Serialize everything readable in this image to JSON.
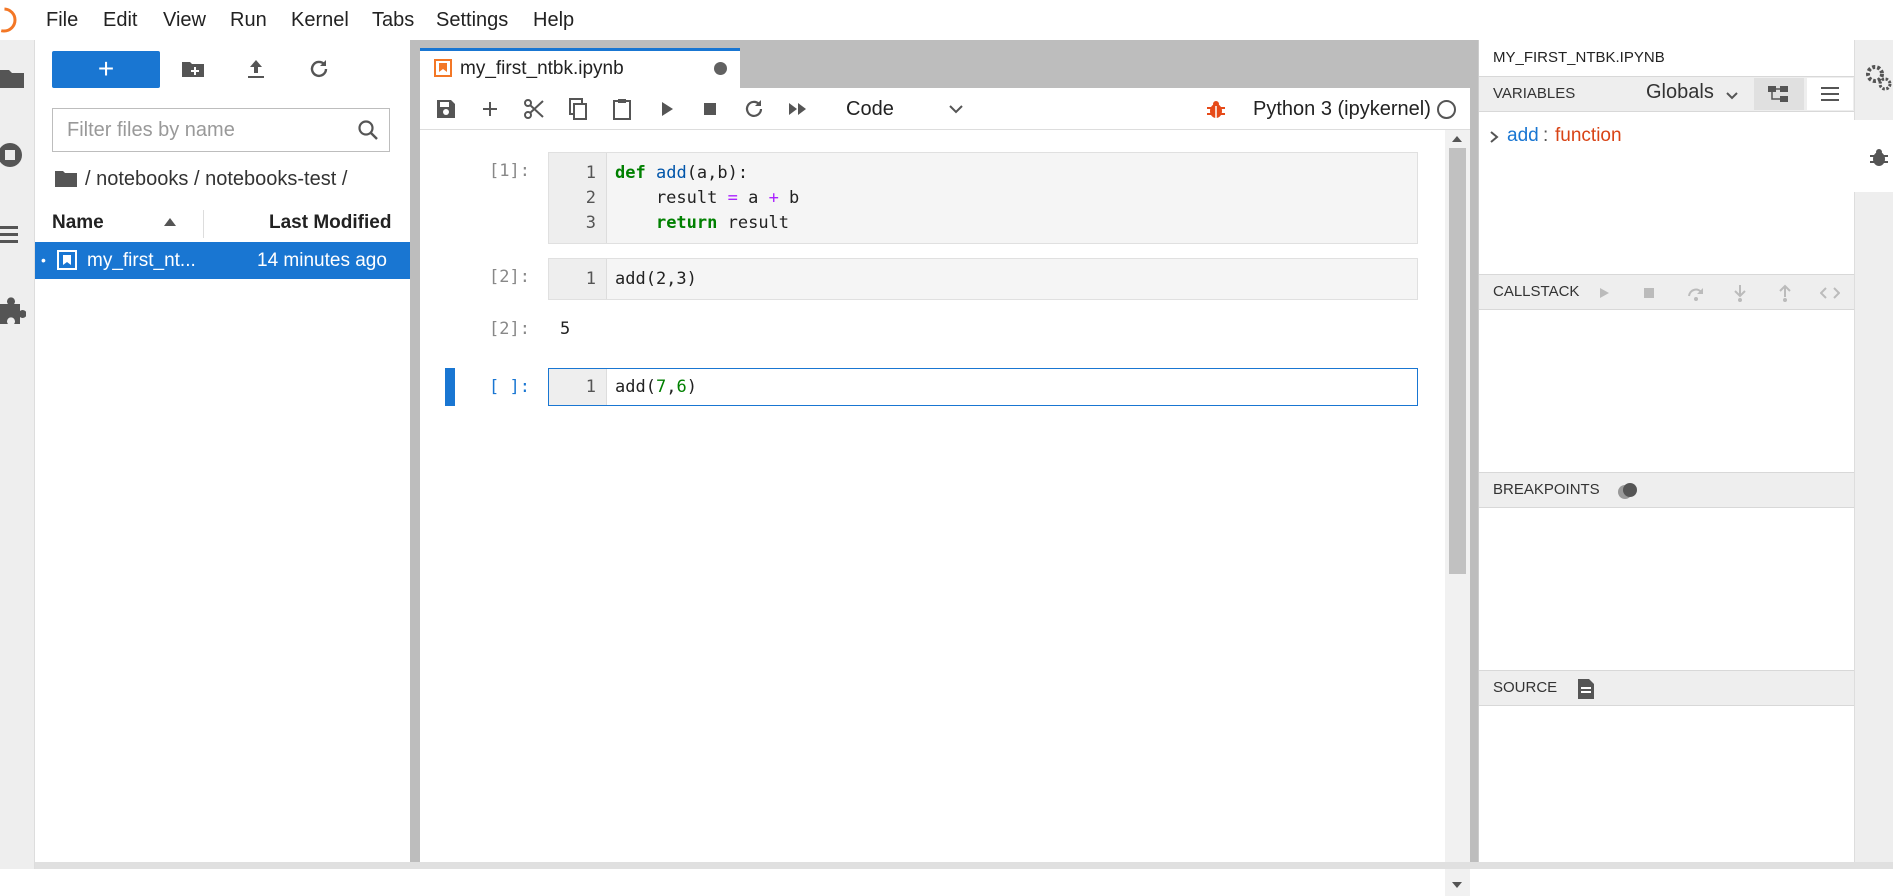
{
  "menubar": {
    "items": [
      "File",
      "Edit",
      "View",
      "Run",
      "Kernel",
      "Tabs",
      "Settings",
      "Help"
    ]
  },
  "filebrowser": {
    "new_button": "+",
    "filter_placeholder": "Filter files by name",
    "breadcrumb": "/ notebooks / notebooks-test /",
    "col_name": "Name",
    "col_modified": "Last Modified",
    "files": [
      {
        "name": "my_first_nt...",
        "modified": "14 minutes ago",
        "selected": true
      }
    ]
  },
  "notebook": {
    "tab_title": "my_first_ntbk.ipynb",
    "cell_type": "Code",
    "kernel": "Python 3 (ipykernel)",
    "cells": [
      {
        "prompt": "[1]:",
        "lines": [
          "1",
          "2",
          "3"
        ]
      },
      {
        "prompt": "[2]:",
        "lines": [
          "1"
        ],
        "code": "add(2,3)",
        "output_prompt": "[2]:",
        "output": "5"
      },
      {
        "prompt": "[ ]:",
        "lines": [
          "1"
        ],
        "code": "add(7,6)"
      }
    ]
  },
  "debugger": {
    "title": "MY_FIRST_NTBK.IPYNB",
    "variables_label": "VARIABLES",
    "scope": "Globals",
    "variable_name": "add",
    "variable_sep": ":",
    "variable_value": "function",
    "callstack_label": "CALLSTACK",
    "breakpoints_label": "BREAKPOINTS",
    "source_label": "SOURCE"
  },
  "colors": {
    "accent": "#1976d2",
    "jupyter_orange": "#f37726",
    "debug_red": "#e64a19"
  }
}
